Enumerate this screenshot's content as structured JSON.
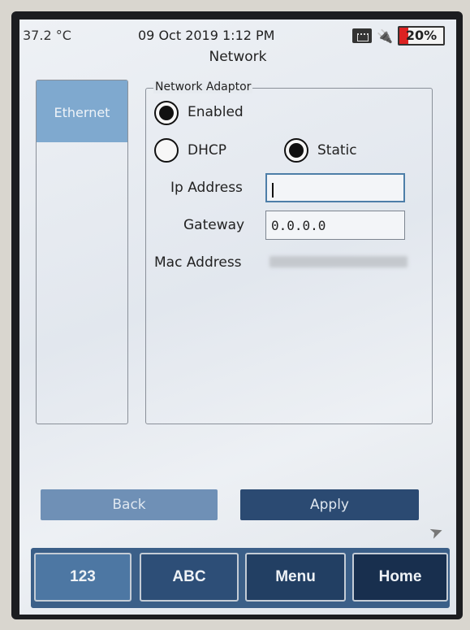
{
  "status": {
    "temperature": "37.2 °C",
    "datetime": "09 Oct 2019 1:12 PM",
    "battery": "20%",
    "battery_level": 0.2,
    "icons": [
      "network-icon",
      "power-plug-icon",
      "battery-icon"
    ]
  },
  "page": {
    "title": "Network"
  },
  "sidebar": {
    "tabs": [
      {
        "label": "Ethernet",
        "selected": true
      }
    ]
  },
  "adaptor": {
    "legend": "Network Adaptor",
    "enabled_label": "Enabled",
    "enabled": true,
    "dhcp_label": "DHCP",
    "static_label": "Static",
    "mode": "Static"
  },
  "fields": {
    "ip_label": "Ip Address",
    "ip_value": "",
    "gateway_label": "Gateway",
    "gateway_value": "0.0.0.0",
    "mac_label": "Mac Address"
  },
  "actions": {
    "back": "Back",
    "apply": "Apply"
  },
  "nav": {
    "num": "123",
    "abc": "ABC",
    "menu": "Menu",
    "home": "Home"
  },
  "colors": {
    "accent": "#7fa9cf",
    "dark_button": "#2b4a72",
    "nav_bar": "#3b5f88",
    "battery_low": "#d22222"
  }
}
